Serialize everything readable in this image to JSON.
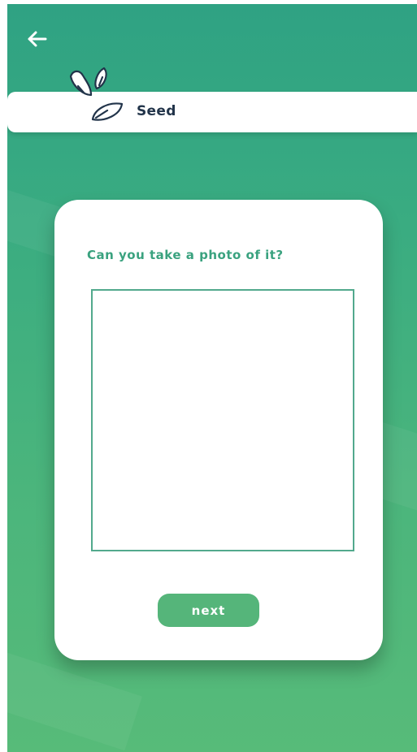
{
  "header": {
    "title": "Seed",
    "back_icon": "arrow-left-icon",
    "logo_icon": "seeds-icon"
  },
  "card": {
    "question": "Can you take a photo of it?",
    "next_label": "next"
  },
  "colors": {
    "accent": "#3aa27f",
    "button": "#55b57a",
    "background_top": "#2fa283",
    "background_bottom": "#57bb79",
    "title_text": "#22344a"
  }
}
